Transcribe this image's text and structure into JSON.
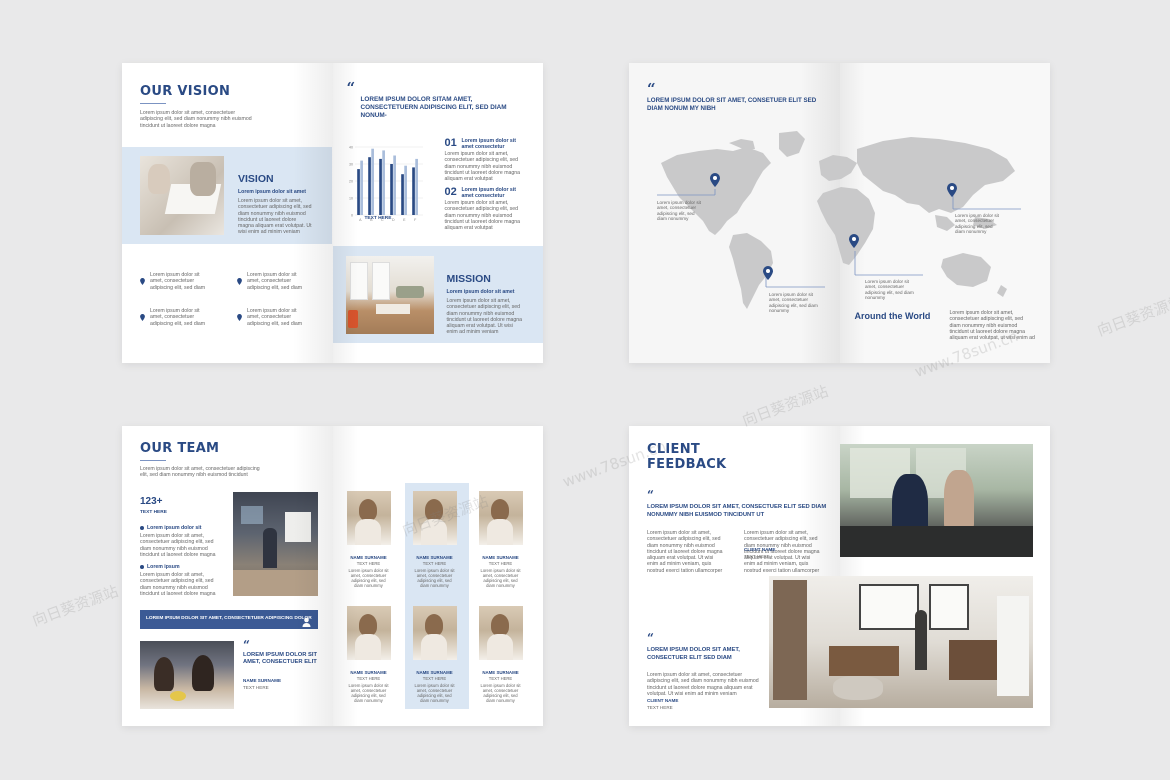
{
  "vision": {
    "title": "OUR VISION",
    "intro": "Lorem ipsum dolor sit amet, consectetuer adipiscing elit, sed diam nonummy nibh euismod tincidunt ut laoreet dolore magna",
    "vision_heading": "VISION",
    "vision_sub": "Lorem ipsum dolor sit amet",
    "vision_body": "Lorem ipsum dolor sit amet, consectetuer adipiscing elit, sed diam nonummy nibh euismod tincidunt ut laoreet dolore magna aliquam erat volutpat. Ut wisi enim ad minim veniam",
    "bullet_text": "Lorem ipsum dolor sit amet, consectetuer adipiscing elit, sed diam",
    "quote_text": "LOREM IPSUM DOLOR SITAM AMET, CONSECTETUERN ADIPISCING ELIT, SED DIAM NONUM-",
    "stat1_num": "01",
    "stat1_title": "Lorem ipsum dolor sit amet consectetur",
    "stat1_body": "Lorem ipsum dolor sit amet, consectetuer adipiscing elit, sed diam nonummy nibh euismod tincidunt ut laoreet dolore magna aliquam erat volutpat",
    "stat2_num": "02",
    "stat2_title": "Lorem ipsum dolor sit amet consectetur",
    "stat2_body": "Lorem ipsum dolor sit amet, consectetuer adipiscing elit, sed diam nonummy nibh euismod tincidunt ut laoreet dolore magna aliquam erat volutpat",
    "mission_heading": "MISSION",
    "mission_sub": "Lorem ipsum dolor sit amet",
    "mission_body": "Lorem ipsum dolor sit amet, consectetuer adipiscing elit, sed diam nonummy nibh euismod tincidunt ut laoreet dolore magna aliquam erat volutpat. Ut wisi enim ad minim veniam"
  },
  "chart_data": {
    "type": "bar",
    "categories": [
      "A",
      "B",
      "C",
      "D",
      "E",
      "F"
    ],
    "series": [
      {
        "values": [
          27,
          34,
          33,
          30,
          24,
          28
        ]
      },
      {
        "values": [
          32,
          39,
          38,
          35,
          29,
          33
        ]
      }
    ],
    "ylim": [
      0,
      40
    ],
    "yticks": [
      0,
      10,
      20,
      30,
      40
    ],
    "xlabel": "TEXT HERE",
    "colors": [
      "#2a4a84",
      "#a9bddb"
    ]
  },
  "world": {
    "quote_text": "LOREM IPSUM DOLOR SIT AMET, CONSETUER ELIT SED DIAM NONUM MY NIBH",
    "label_text": "Lorem ipsum dolor sit amet, consectetuer adipiscing elit, sed diam nonummy",
    "around_title": "Around the World",
    "around_body": "Lorem ipsum dolor sit amet, consectetuer adipiscing elit, sed diam nonummy nibh euismod tincidunt ut laoreet dolore magna aliquam erat volutpat, ut wisi enim ad"
  },
  "team": {
    "title": "OUR TEAM",
    "intro": "Lorem ipsum dolor sit amet, consectetuer adipiscing elit, sed diam nonummy nibh euismod tincidunt",
    "count": "123+",
    "count_label": "TEXT HERE",
    "bullet1_title": "Lorem ipsum dolor sit",
    "bullet1_body": "Lorem ipsum dolor sit amet, consectetuer adipiscing elit, sed diam nonummy nibh euismod tincidunt ut laoreet dolore magna",
    "bullet2_title": "Lorem ipsum",
    "bullet2_body": "Lorem ipsum dolor sit amet, consectetuer adipiscing elit, sed diam nonummy nibh euismod tincidunt ut laoreet dolore magna",
    "banner_text": "LOREM IPSUM DOLOR SIT AMET, CONSECTETUER ADIPISCING  DOLOR",
    "quote_text": "LOREM IPSUM DOLOR SIT AMET, CONSECTUER ELIT",
    "quote_name": "NAME SURNAME",
    "quote_role": "TEXT HERE",
    "member_name": "NAME SURNAME",
    "member_role": "TEXT HERE",
    "member_body": "Lorem ipsum dolor sit amet, consectetuer adipiscing elit, sed diam nonummy"
  },
  "feedback": {
    "title_line1": "CLIENT",
    "title_line2": "FEEDBACK",
    "quote1": "LOREM IPSUM DOLOR SIT AMET, CONSECTUER ELIT SED DIAM NONUMMY NIBH EUISMOD TINCIDUNT UT",
    "body": "Lorem ipsum dolor sit amet, consectetuer adipiscing elit, sed diam nonummy nibh euismod tincidunt ut laoreet dolore magna aliquam erat volutpat. Ut wisi enim ad minim veniam, quis nostrud exerci tation ullamcorper",
    "client_label": "CLIENT NAME",
    "client_role": "TEXT HERE",
    "quote2": "LOREM IPSUM DOLOR SIT AMET, CONSECTUER ELIT SED DIAM",
    "body2": "Lorem ipsum dolor sit amet, consectetuer adipiscing elit, sed diam nonummy nibh euismod tincidunt ut laoreet dolore magna aliquam erat volutpat. Ut wisi enim ad minim veniam"
  },
  "watermark": {
    "text1": "向日葵资源站",
    "text2": "www.78sun.cn"
  }
}
